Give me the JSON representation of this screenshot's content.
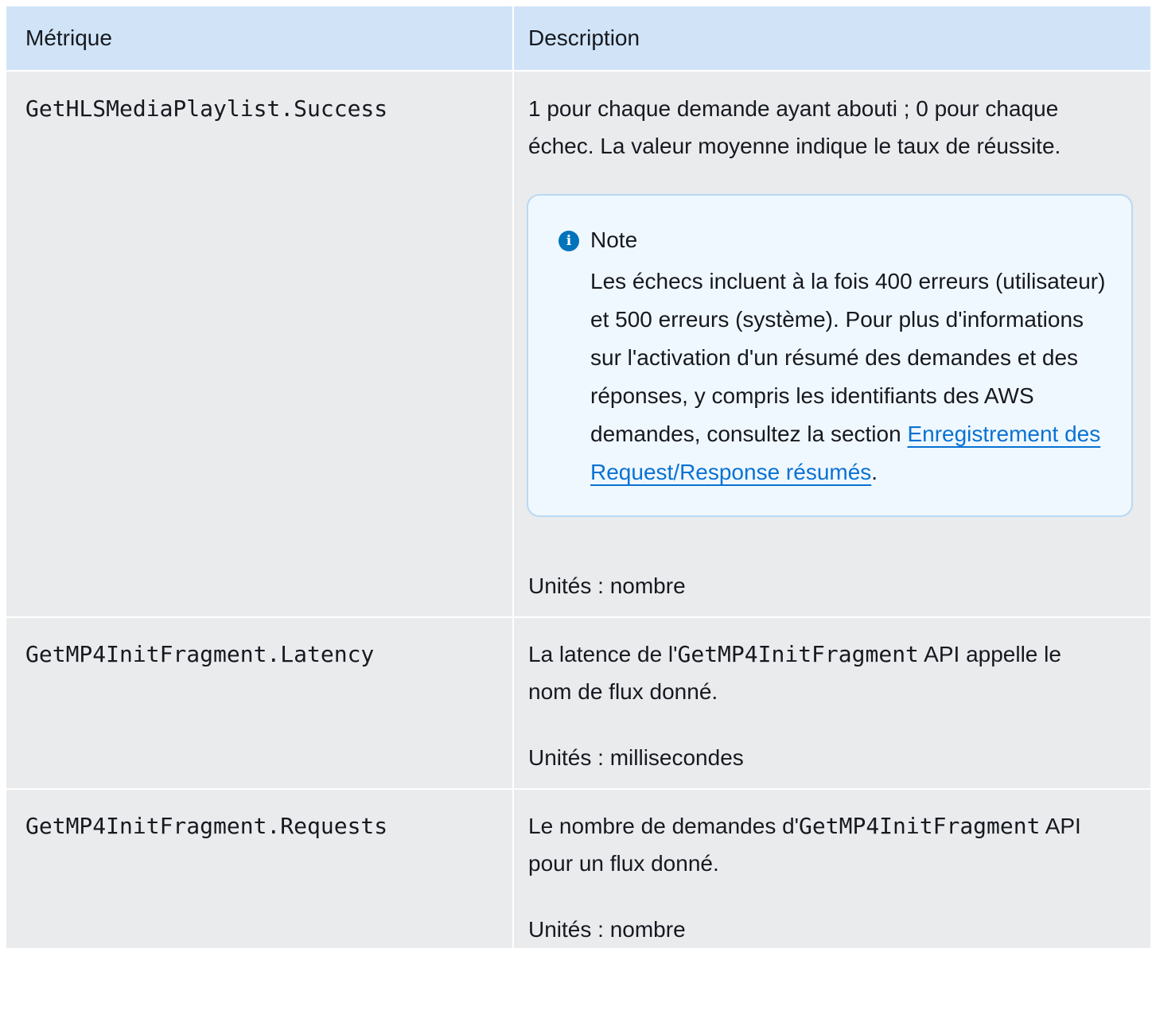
{
  "header": {
    "col1": "Métrique",
    "col2": "Description"
  },
  "rows": [
    {
      "metric": "GetHLSMediaPlaylist.Success",
      "description": "1 pour chaque demande ayant abouti ; 0 pour chaque échec. La valeur moyenne indique le taux de réussite.",
      "note": {
        "icon": "info-icon",
        "title": "Note",
        "body_before_link": "Les échecs incluent à la fois 400 erreurs (utilisateur) et 500 erreurs (système). Pour plus d'informations sur l'activation d'un résumé des demandes et des réponses, y compris les identifiants des AWS demandes, consultez la section ",
        "link_text": "Enregistrement des Request/Response résumés",
        "body_after_link": "."
      },
      "units": "Unités : nombre"
    },
    {
      "metric": "GetMP4InitFragment.Latency",
      "description_before_code": "La latence de l'",
      "code": "GetMP4InitFragment",
      "description_after_code": " API appelle le nom de flux donné.",
      "units": "Unités : millisecondes"
    },
    {
      "metric": "GetMP4InitFragment.Requests",
      "description_before_code": "Le nombre de demandes d'",
      "code": "GetMP4InitFragment",
      "description_after_code": " API pour un flux donné.",
      "units": "Unités : nombre"
    }
  ],
  "colors": {
    "header_bg": "#d1e4f7",
    "cell_bg": "#e9ebed",
    "note_bg": "#f0f8ff",
    "note_border": "#b9d9f2",
    "link": "#0972d3",
    "info_icon": "#0073bb"
  }
}
